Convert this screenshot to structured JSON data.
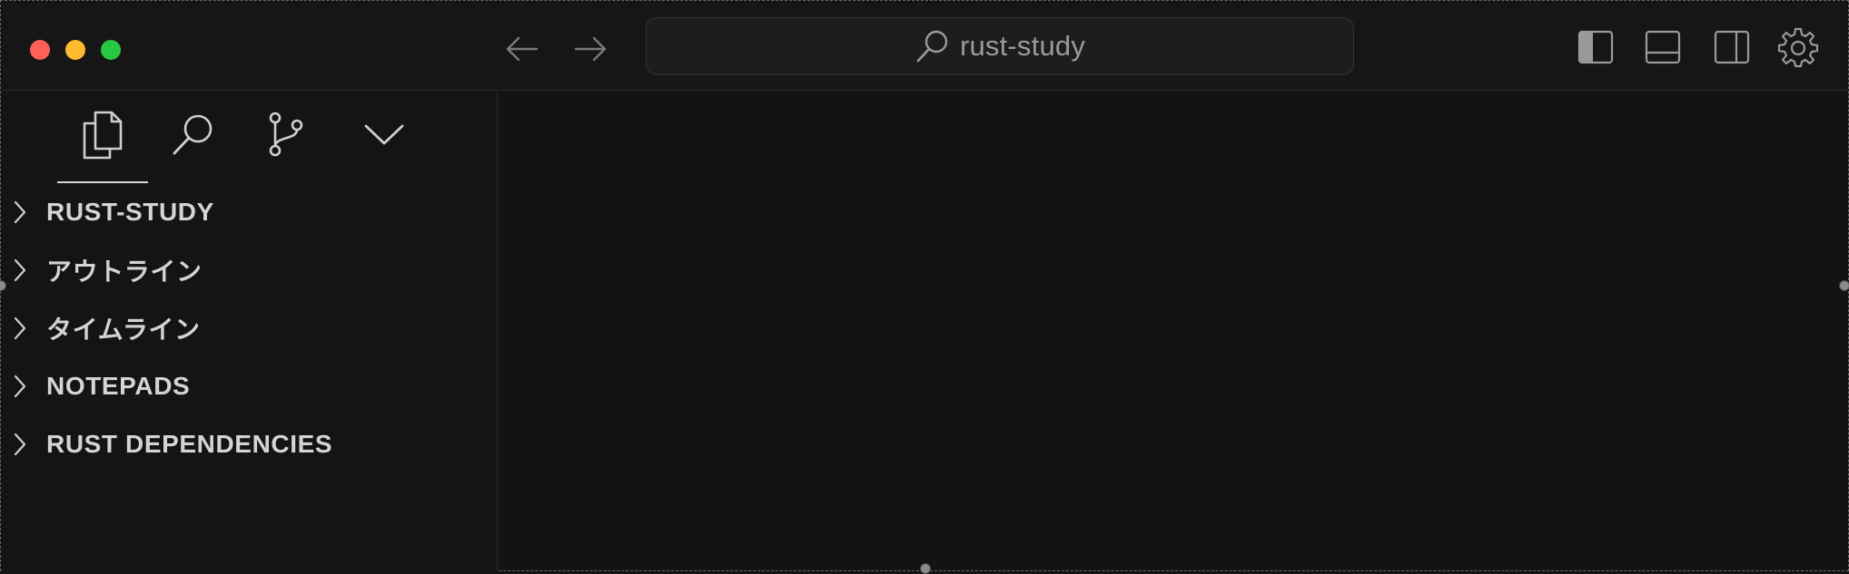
{
  "titlebar": {
    "search_text": "rust-study",
    "icons": {
      "back": "arrow-left-icon",
      "forward": "arrow-right-icon",
      "search": "search-icon",
      "toggle_primary_sidebar": "layout-sidebar-left-icon",
      "toggle_panel": "layout-panel-icon",
      "toggle_secondary_sidebar": "layout-sidebar-right-icon",
      "settings": "gear-icon"
    }
  },
  "activity_bar": {
    "items": [
      "files-icon",
      "search-icon",
      "source-control-icon",
      "chevron-down-icon"
    ],
    "active": "files-icon"
  },
  "sidebar": {
    "sections": [
      {
        "label": "RUST-STUDY",
        "expanded": false
      },
      {
        "label": "アウトライン",
        "expanded": false
      },
      {
        "label": "タイムライン",
        "expanded": false
      },
      {
        "label": "NOTEPADS",
        "expanded": false
      },
      {
        "label": "RUST DEPENDENCIES",
        "expanded": false
      }
    ]
  },
  "colors": {
    "background": "#141414",
    "close": "#fe5f57",
    "minimize": "#febb2e",
    "zoom": "#28c840",
    "text": "#d4d4d4"
  }
}
